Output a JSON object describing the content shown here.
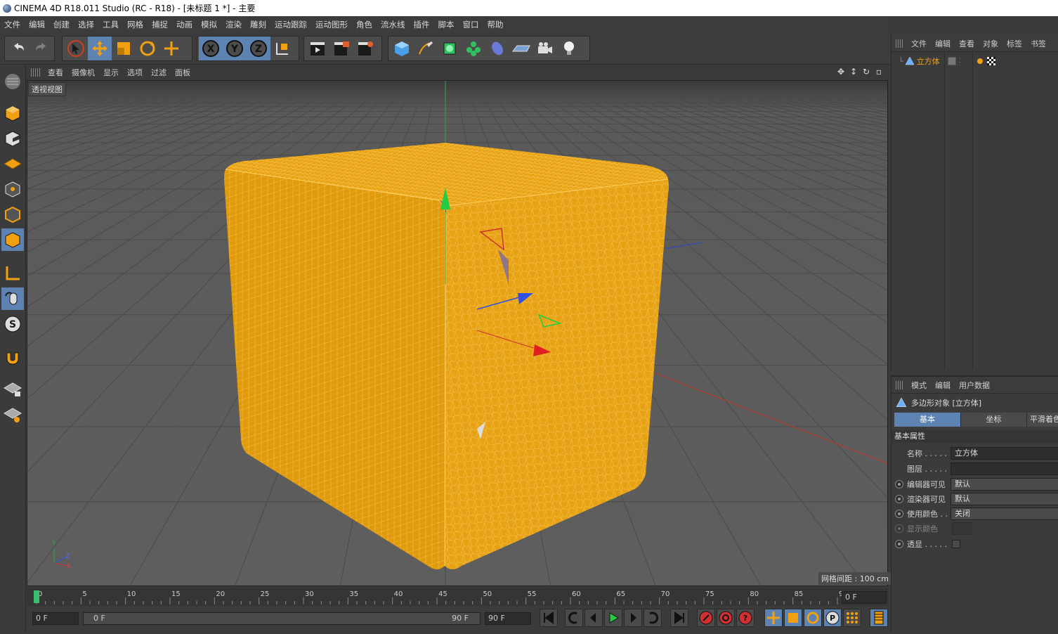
{
  "window": {
    "title": "CINEMA 4D R18.011 Studio (RC - R18) - [未标题 1 *] - 主要"
  },
  "menu": [
    "文件",
    "编辑",
    "创建",
    "选择",
    "工具",
    "网格",
    "捕捉",
    "动画",
    "模拟",
    "渲染",
    "雕刻",
    "运动跟踪",
    "运动图形",
    "角色",
    "流水线",
    "插件",
    "脚本",
    "窗口",
    "帮助"
  ],
  "toolbar": {
    "axis_x": "X",
    "axis_y": "Y",
    "axis_z": "Z",
    "icons": [
      "undo-icon",
      "redo-icon",
      "select-icon",
      "move-icon",
      "scale-icon",
      "rotate-icon",
      "live-select-icon",
      "x-axis-icon",
      "y-axis-icon",
      "z-axis-icon",
      "coordinate-system-icon",
      "render-view-icon",
      "render-picture-viewer-icon",
      "edit-render-settings-icon",
      "cube-icon",
      "pen-icon",
      "subdivision-icon",
      "cloner-icon",
      "deformer-icon",
      "floor-icon",
      "camera-icon",
      "light-icon"
    ]
  },
  "viewport": {
    "menu": [
      "查看",
      "摄像机",
      "显示",
      "选项",
      "过滤",
      "面板"
    ],
    "label": "透视视图",
    "grid_info": "网格间距 : 100 cm",
    "axis_y": "Y",
    "axis_z": "Z",
    "axis_x": "X"
  },
  "timeline": {
    "ticks": [
      "0",
      "5",
      "10",
      "15",
      "20",
      "25",
      "30",
      "35",
      "40",
      "45",
      "50",
      "55",
      "60",
      "65",
      "70",
      "75",
      "80",
      "85",
      "90"
    ],
    "current_frame": "0 F",
    "start_field": "0 F",
    "range_start": "0 F",
    "range_end": "90 F",
    "end_field": "90 F"
  },
  "object_manager": {
    "menu": [
      "文件",
      "编辑",
      "查看",
      "对象",
      "标签",
      "书签"
    ],
    "object_name": "立方体"
  },
  "attributes": {
    "menu": [
      "模式",
      "编辑",
      "用户数据"
    ],
    "object_title": "多边形对象 [立方体]",
    "tabs": [
      "基本",
      "坐标",
      "平滑着色"
    ],
    "section": "基本属性",
    "rows": [
      {
        "label": "名称 . . . . .",
        "value": "立方体"
      },
      {
        "label": "图层 . . . . .",
        "value": ""
      },
      {
        "label": "编辑器可见",
        "value": "默认"
      },
      {
        "label": "渲染器可见",
        "value": "默认"
      },
      {
        "label": "使用颜色 . .",
        "value": "关闭"
      },
      {
        "label": "显示颜色",
        "value": ""
      },
      {
        "label": "透显 . . . . .",
        "value": ""
      }
    ]
  },
  "colors": {
    "accent": "#5d83b2",
    "cube_fill": "#e8a010",
    "cube_wire": "#f7b73c",
    "timeline_marker": "#38c070"
  }
}
